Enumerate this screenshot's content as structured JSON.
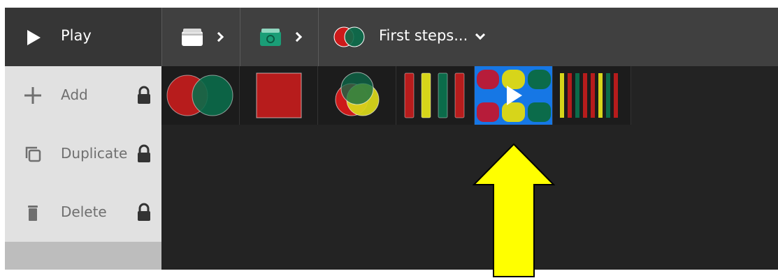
{
  "topbar": {
    "play_label": "Play",
    "breadcrumbs": [
      {
        "icon": "folder-icon",
        "color": "#ffffff"
      },
      {
        "icon": "folder-icon",
        "color": "#1a9e77"
      }
    ],
    "current_title": "First steps..."
  },
  "sidebar": {
    "items": [
      {
        "label": "Add",
        "icon": "plus-icon",
        "locked": true
      },
      {
        "label": "Duplicate",
        "icon": "duplicate-icon",
        "locked": true
      },
      {
        "label": "Delete",
        "icon": "trash-icon",
        "locked": true
      }
    ]
  },
  "thumbnails": [
    {
      "name": "two-circles",
      "selected": false
    },
    {
      "name": "red-square",
      "selected": false
    },
    {
      "name": "three-circles",
      "selected": false
    },
    {
      "name": "four-bars",
      "selected": false
    },
    {
      "name": "rounded-grid-play",
      "selected": true
    },
    {
      "name": "many-bars",
      "selected": false
    }
  ],
  "colors": {
    "red": "#b71c1c",
    "green": "#0b6b4a",
    "yellow": "#d7d51a",
    "selected_bg": "#1677e5",
    "arrow": "#ffff00"
  }
}
